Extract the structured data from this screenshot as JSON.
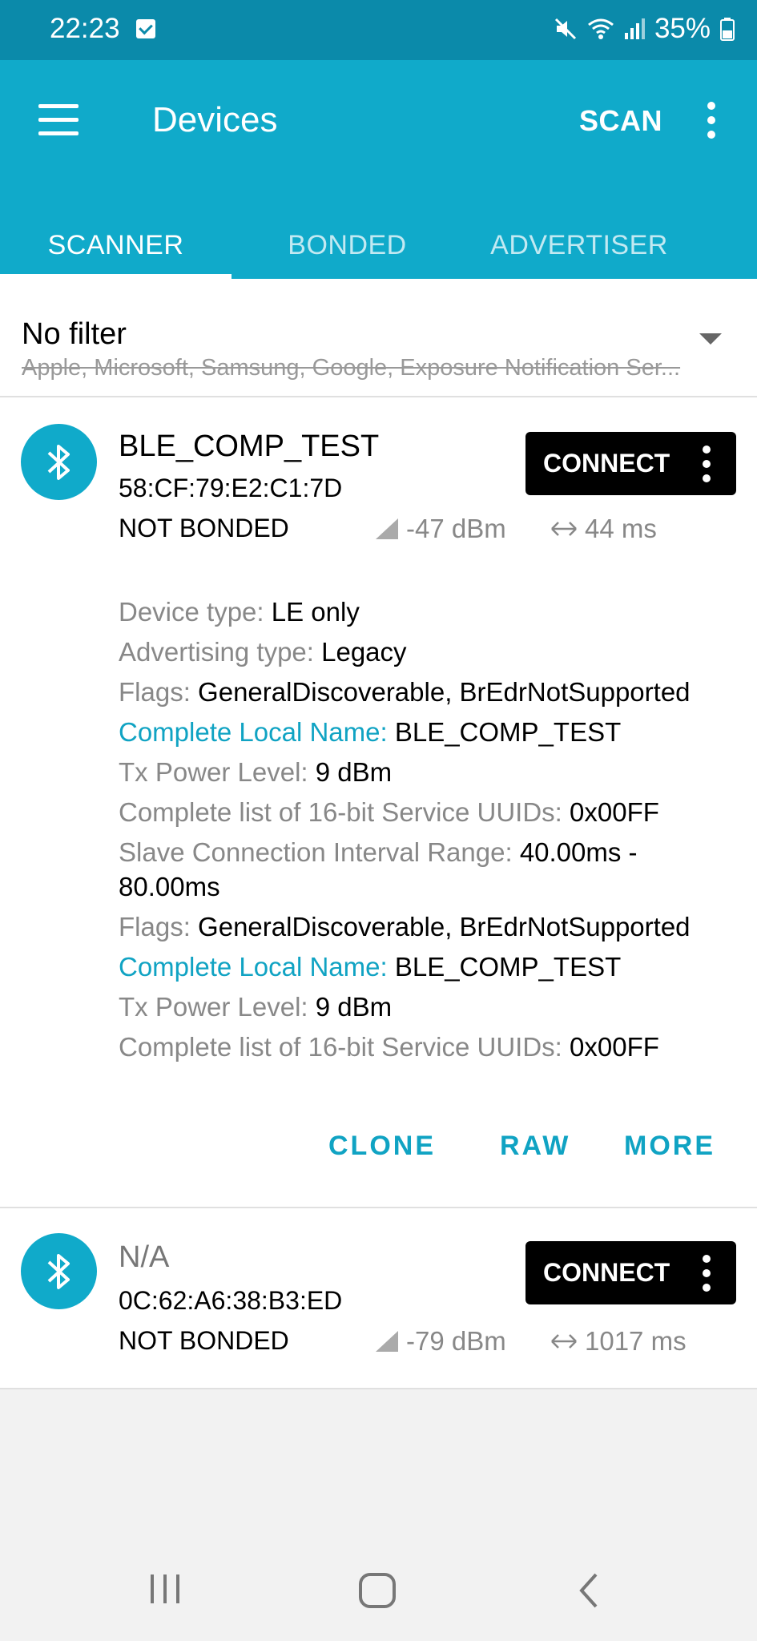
{
  "status_bar": {
    "time": "22:23",
    "battery": "35%"
  },
  "app_bar": {
    "title": "Devices",
    "scan_label": "SCAN"
  },
  "tabs": [
    {
      "label": "SCANNER",
      "active": true
    },
    {
      "label": "BONDED",
      "active": false
    },
    {
      "label": "ADVERTISER",
      "active": false
    }
  ],
  "filter": {
    "title": "No filter",
    "excluded": "Apple, Microsoft, Samsung, Google, Exposure Notification Ser..."
  },
  "devices": [
    {
      "name": "BLE_COMP_TEST",
      "address": "58:CF:79:E2:C1:7D",
      "bond_state": "NOT BONDED",
      "rssi": "-47 dBm",
      "interval": "44 ms",
      "connect_label": "CONNECT",
      "details": [
        {
          "key": "Device type: ",
          "value": "LE only",
          "highlight": false
        },
        {
          "key": "Advertising type: ",
          "value": "Legacy",
          "highlight": false
        },
        {
          "key": "Flags: ",
          "value": "GeneralDiscoverable, BrEdrNotSupported",
          "highlight": false
        },
        {
          "key": "Complete Local Name: ",
          "value": "BLE_COMP_TEST",
          "highlight": true
        },
        {
          "key": "Tx Power Level: ",
          "value": "9 dBm",
          "highlight": false
        },
        {
          "key": "Complete list of 16-bit Service UUIDs: ",
          "value": "0x00FF",
          "highlight": false
        },
        {
          "key": "Slave Connection Interval Range: ",
          "value": "40.00ms - 80.00ms",
          "highlight": false
        },
        {
          "key": "Flags: ",
          "value": "GeneralDiscoverable, BrEdrNotSupported",
          "highlight": false
        },
        {
          "key": "Complete Local Name: ",
          "value": "BLE_COMP_TEST",
          "highlight": true
        },
        {
          "key": "Tx Power Level: ",
          "value": "9 dBm",
          "highlight": false
        },
        {
          "key": "Complete list of 16-bit Service UUIDs: ",
          "value": "0x00FF",
          "highlight": false
        }
      ],
      "actions": {
        "clone": "CLONE",
        "raw": "RAW",
        "more": "MORE"
      }
    },
    {
      "name": "N/A",
      "address": "0C:62:A6:38:B3:ED",
      "bond_state": "NOT BONDED",
      "rssi": "-79 dBm",
      "interval": "1017 ms",
      "connect_label": "CONNECT"
    }
  ],
  "colors": {
    "primary": "#10aaca",
    "primary_dark": "#0b8aaa",
    "accent_text": "#10a3c3"
  }
}
